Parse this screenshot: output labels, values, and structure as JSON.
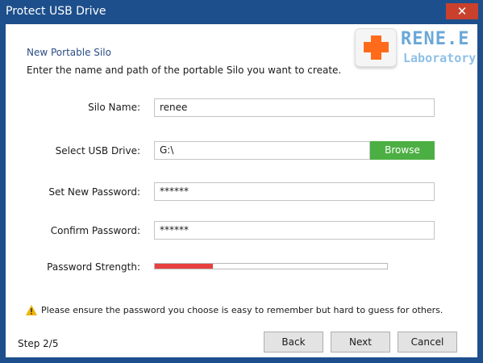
{
  "window": {
    "title": "Protect USB Drive",
    "close_symbol": "✕"
  },
  "logo": {
    "brand": "RENE.E",
    "sub": "Laboratory",
    "icon": "plus-cross-icon"
  },
  "header": {
    "heading": "New Portable Silo",
    "instruction": "Enter the name and path of the portable Silo you want to create."
  },
  "form": {
    "silo_name_label": "Silo Name:",
    "silo_name_value": "renee",
    "usb_drive_label": "Select USB Drive:",
    "usb_drive_value": "G:\\",
    "browse_label": "Browse",
    "new_password_label": "Set New Password:",
    "new_password_value": "******",
    "confirm_password_label": "Confirm Password:",
    "confirm_password_value": "******",
    "strength_label": "Password Strength:",
    "strength_fraction": 0.25
  },
  "note": {
    "icon": "warning-icon",
    "text": "Please ensure the password you choose is easy to remember but hard to guess for others."
  },
  "footer": {
    "step": "Step  2/5",
    "back_label": "Back",
    "next_label": "Next",
    "cancel_label": "Cancel"
  },
  "colors": {
    "titlebar": "#1d4f8c",
    "close": "#c9402d",
    "browse": "#4caf43",
    "strength": "#e8403f",
    "heading": "#2b4c86"
  }
}
